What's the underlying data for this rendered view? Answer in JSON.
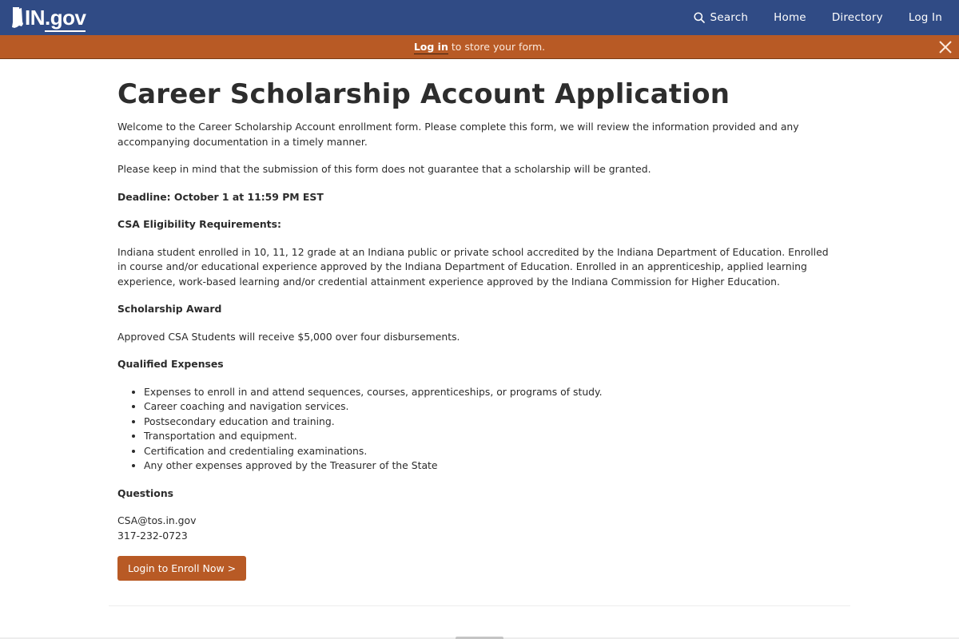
{
  "header": {
    "logo_text_main": "IN",
    "logo_text_suffix": ".gov",
    "nav": [
      {
        "label": "Search",
        "icon": "search-icon"
      },
      {
        "label": "Home"
      },
      {
        "label": "Directory"
      },
      {
        "label": "Log In"
      }
    ]
  },
  "banner": {
    "link_label": "Log in",
    "message": " to store your form.",
    "close_icon": "close-icon"
  },
  "page": {
    "title": "Career Scholarship Account Application",
    "intro": "Welcome to the Career Scholarship Account enrollment form.  Please complete this form, we will review the information provided and any accompanying documentation in a timely manner.",
    "disclaimer": "Please keep in mind that the submission of this form does not guarantee that a scholarship will be granted.",
    "deadline": "Deadline: October 1 at 11:59 PM EST",
    "eligibility_heading": "CSA Eligibility Requirements:",
    "eligibility_text": "Indiana student enrolled in 10, 11, 12 grade at an Indiana public or private school accredited by the Indiana Department of Education. Enrolled in course and/or educational experience approved by the Indiana Department of Education. Enrolled in an apprenticeship, applied learning experience, work-based learning and/or credential attainment experience approved by the Indiana Commission for Higher Education.",
    "award_heading": "Scholarship Award",
    "award_text": "Approved CSA Students will receive $5,000 over four disbursements.",
    "expenses_heading": "Qualified Expenses",
    "expenses": [
      "Expenses to enroll in and attend sequences, courses, apprenticeships, or programs of study.",
      "Career coaching and navigation services.",
      "Postsecondary education and training.",
      "Transportation and equipment.",
      "Certification and credentialing examinations.",
      "Any other expenses approved by the Treasurer of the State"
    ],
    "questions_heading": "Questions",
    "contact_email": "CSA@tos.in.gov",
    "contact_phone": "317-232-0723",
    "enroll_button": "Login to Enroll Now >"
  },
  "colors": {
    "header_bg": "#304b85",
    "banner_bg": "#b85a25",
    "button_bg": "#b85a25"
  }
}
